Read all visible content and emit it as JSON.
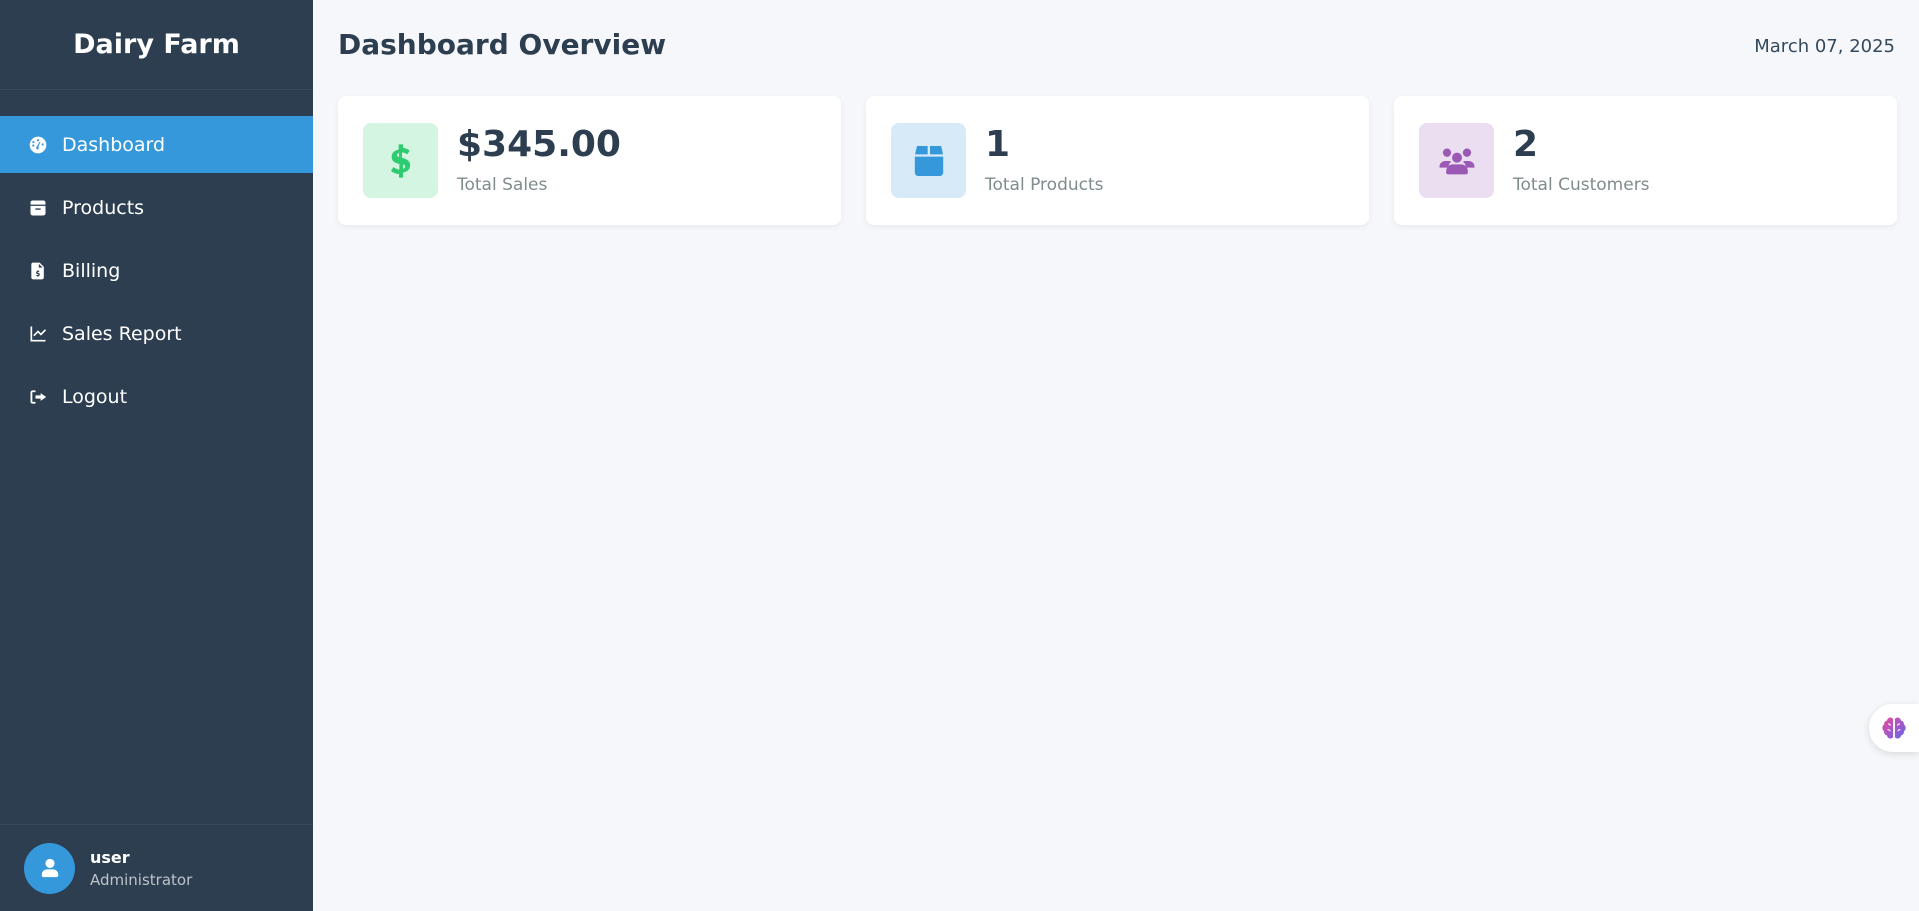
{
  "sidebar": {
    "brand": "Dairy Farm",
    "items": [
      {
        "label": "Dashboard",
        "icon": "dashboard-gauge-icon",
        "active": true
      },
      {
        "label": "Products",
        "icon": "box-icon",
        "active": false
      },
      {
        "label": "Billing",
        "icon": "invoice-icon",
        "active": false
      },
      {
        "label": "Sales Report",
        "icon": "line-chart-icon",
        "active": false
      },
      {
        "label": "Logout",
        "icon": "logout-icon",
        "active": false
      }
    ],
    "user": {
      "name": "user",
      "role": "Administrator",
      "icon": "user-icon"
    }
  },
  "header": {
    "title": "Dashboard Overview",
    "date": "March 07, 2025"
  },
  "stats": [
    {
      "value": "$345.00",
      "label": "Total Sales",
      "icon": "dollar-icon",
      "color": "#2ecc71",
      "bg": "#d5f5e3"
    },
    {
      "value": "1",
      "label": "Total Products",
      "icon": "box-icon",
      "color": "#3498db",
      "bg": "#d6eaf8"
    },
    {
      "value": "2",
      "label": "Total Customers",
      "icon": "users-icon",
      "color": "#9b59b6",
      "bg": "#ebdef0"
    }
  ],
  "colors": {
    "sidebar_bg": "#2c3e50",
    "accent": "#3498db",
    "page_bg": "#f5f7fa"
  },
  "float_button": {
    "icon": "brain-icon"
  }
}
